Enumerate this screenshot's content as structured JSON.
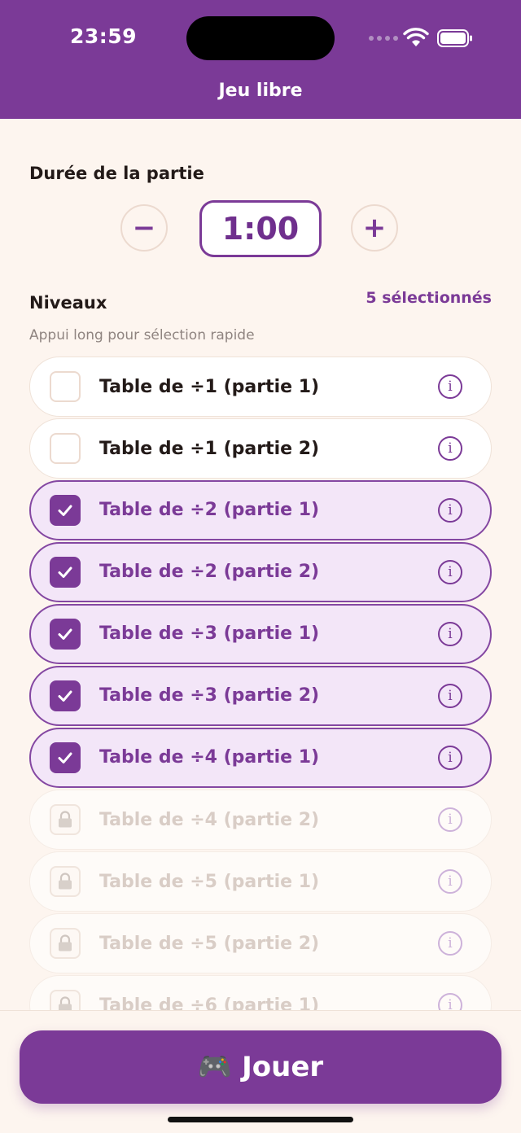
{
  "status_bar": {
    "time": "23:59"
  },
  "nav": {
    "title": "Jeu libre"
  },
  "duration": {
    "title": "Durée de la partie",
    "minus_label": "−",
    "value": "1:00",
    "plus_label": "+"
  },
  "levels": {
    "title": "Niveaux",
    "selected_count": "5 sélectionnés",
    "hint": "Appui long pour sélection rapide",
    "items": [
      {
        "label": "Table de ÷1 (partie 1)",
        "state": "unchecked"
      },
      {
        "label": "Table de ÷1 (partie 2)",
        "state": "unchecked"
      },
      {
        "label": "Table de ÷2 (partie 1)",
        "state": "checked"
      },
      {
        "label": "Table de ÷2 (partie 2)",
        "state": "checked"
      },
      {
        "label": "Table de ÷3 (partie 1)",
        "state": "checked"
      },
      {
        "label": "Table de ÷3 (partie 2)",
        "state": "checked"
      },
      {
        "label": "Table de ÷4 (partie 1)",
        "state": "checked"
      },
      {
        "label": "Table de ÷4 (partie 2)",
        "state": "locked"
      },
      {
        "label": "Table de ÷5 (partie 1)",
        "state": "locked"
      },
      {
        "label": "Table de ÷5 (partie 2)",
        "state": "locked"
      },
      {
        "label": "Table de ÷6 (partie 1)",
        "state": "locked"
      }
    ],
    "info_icon": "info-icon"
  },
  "play_button": {
    "icon": "🎮",
    "label": "Jouer"
  },
  "colors": {
    "primary": "#7b3a97",
    "background": "#fdf5ef",
    "selected_row": "#f3e6f8"
  }
}
